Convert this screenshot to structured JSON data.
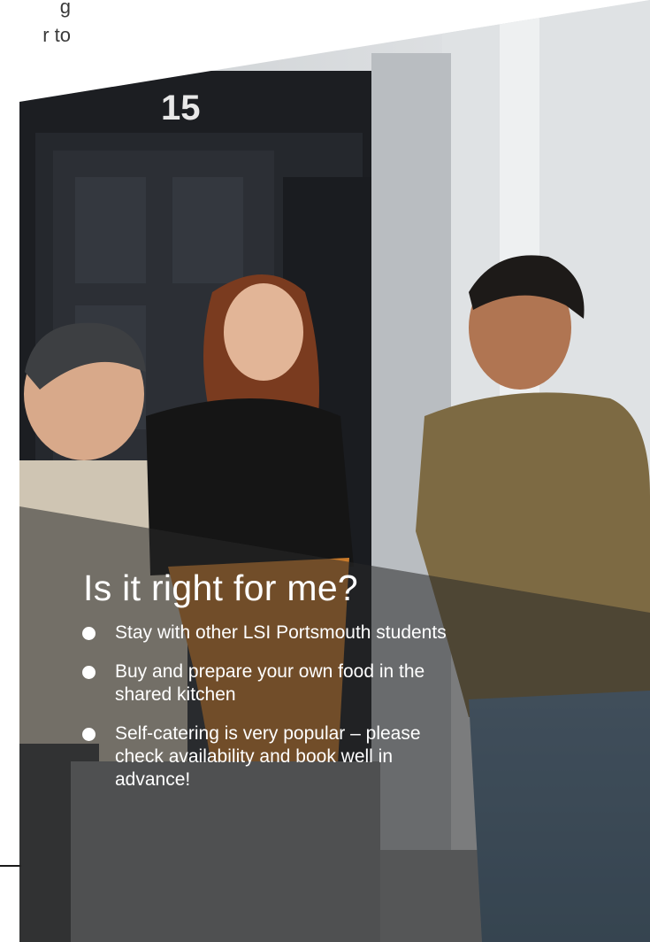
{
  "intro_fragment": {
    "line1": "g",
    "line2": "r to"
  },
  "photo": {
    "door_number": "15",
    "description_icon": "students-photo"
  },
  "info": {
    "title": "Is it right for me?",
    "items": [
      {
        "text": "Stay with other LSI Portsmouth students"
      },
      {
        "text": "Buy and prepare your own food in the shared kitchen"
      },
      {
        "text": "Self-catering is very popular – please check availability and book well in advance!"
      }
    ]
  },
  "colors": {
    "overlay": "#282828",
    "text_light": "#ffffff",
    "text_dark": "#3a3a3a"
  }
}
